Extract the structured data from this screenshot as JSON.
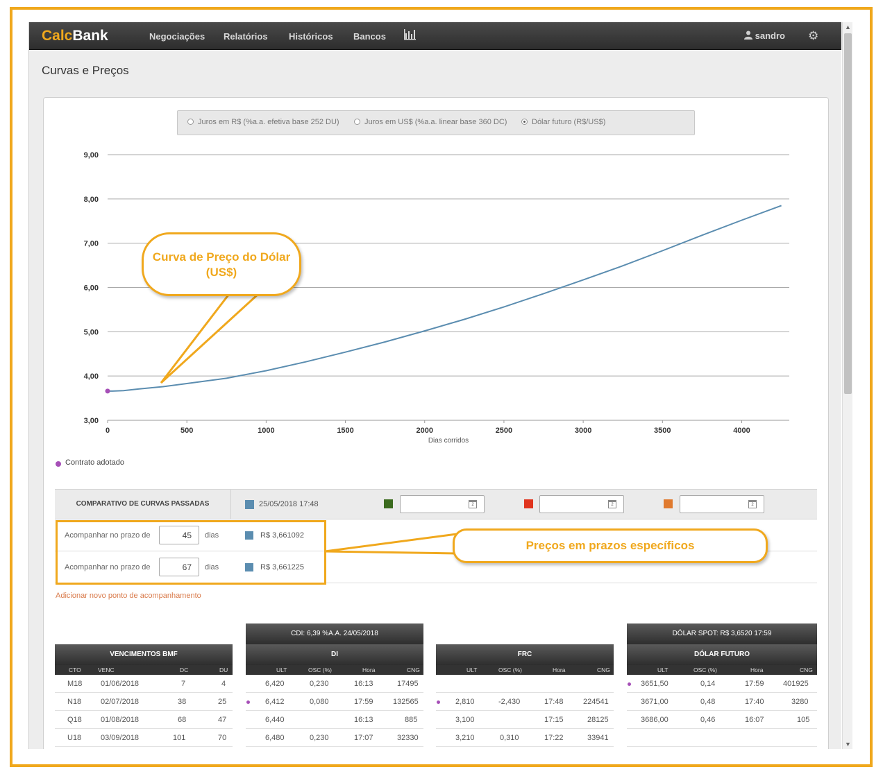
{
  "app": {
    "brand_part1": "Calc",
    "brand_part2": "Bank",
    "nav": [
      "Negociações",
      "Relatórios",
      "Históricos",
      "Bancos"
    ],
    "chart_icon": "bar-chart-icon",
    "user": "sandro",
    "user_icon": "user-icon",
    "settings_icon": "gear-icon"
  },
  "page": {
    "title": "Curvas e Preços"
  },
  "curve_options": [
    {
      "label": "Juros em R$ (%a.a. efetiva base 252 DU)",
      "selected": false
    },
    {
      "label": "Juros em US$ (%a.a. linear base 360 DC)",
      "selected": false
    },
    {
      "label": "Dólar futuro (R$/US$)",
      "selected": true
    }
  ],
  "chart_data": {
    "type": "line",
    "xlabel": "Dias corridos",
    "ylabel": "",
    "xlim": [
      0,
      4300
    ],
    "ylim": [
      3.0,
      9.0
    ],
    "x_ticks": [
      "0",
      "500",
      "1000",
      "1500",
      "2000",
      "2500",
      "3000",
      "3500",
      "4000"
    ],
    "y_ticks": [
      "3,00",
      "4,00",
      "5,00",
      "6,00",
      "7,00",
      "8,00",
      "9,00"
    ],
    "grid": true,
    "series": [
      {
        "color": "#5b8db0",
        "x": [
          0,
          30,
          100,
          200,
          350,
          500,
          750,
          1000,
          1250,
          1500,
          1750,
          2000,
          2250,
          2500,
          2750,
          3000,
          3250,
          3500,
          3750,
          4000,
          4250
        ],
        "y": [
          3.66,
          3.66,
          3.67,
          3.71,
          3.76,
          3.83,
          3.95,
          4.12,
          4.32,
          4.54,
          4.77,
          5.02,
          5.28,
          5.56,
          5.86,
          6.17,
          6.49,
          6.83,
          7.18,
          7.52,
          7.85
        ]
      }
    ],
    "adopted_contract": {
      "x": 0,
      "y": 3.66,
      "color": "#a64fb7"
    },
    "legend": "Contrato adotado",
    "legend_placement": "bottom-left"
  },
  "compare": {
    "title": "COMPARATIVO DE CURVAS PASSADAS",
    "date1": "25/05/2018 17:48",
    "colors": [
      "#5b8db0",
      "#3b6b1e",
      "#e0341e",
      "#e07a2e"
    ]
  },
  "tracking": [
    {
      "label": "Acompanhar no prazo de",
      "days": "45",
      "unit": "dias",
      "value": "R$ 3,661092"
    },
    {
      "label": "Acompanhar no prazo de",
      "days": "67",
      "unit": "dias",
      "value": "R$ 3,661225"
    }
  ],
  "add_point": "Adicionar novo ponto de acompanhamento",
  "callouts": {
    "curve": "Curva de Preço do Dólar (US$)",
    "prices": "Preços em prazos específicos"
  },
  "tables": {
    "bmf": {
      "title": "VENCIMENTOS BMF",
      "cols": [
        "CTO",
        "VENC",
        "DC",
        "DU"
      ],
      "rows": [
        [
          "M18",
          "01/06/2018",
          "7",
          "4"
        ],
        [
          "N18",
          "02/07/2018",
          "38",
          "25"
        ],
        [
          "Q18",
          "01/08/2018",
          "68",
          "47"
        ],
        [
          "U18",
          "03/09/2018",
          "101",
          "70"
        ]
      ]
    },
    "di": {
      "pre": "CDI: 6,39 %A.A.      24/05/2018",
      "title": "DI",
      "cols": [
        "ULT",
        "OSC (%)",
        "Hora",
        "CNG"
      ],
      "rows": [
        [
          "6,420",
          "0,230",
          "16:13",
          "17495"
        ],
        [
          "6,412",
          "0,080",
          "17:59",
          "132565"
        ],
        [
          "6,440",
          "",
          "16:13",
          "885"
        ],
        [
          "6,480",
          "0,230",
          "17:07",
          "32330"
        ]
      ]
    },
    "frc": {
      "title": "FRC",
      "cols": [
        "ULT",
        "OSC (%)",
        "Hora",
        "CNG"
      ],
      "rows": [
        [
          "",
          "",
          "",
          ""
        ],
        [
          "2,810",
          "-2,430",
          "17:48",
          "224541"
        ],
        [
          "3,100",
          "",
          "17:15",
          "28125"
        ],
        [
          "3,210",
          "0,310",
          "17:22",
          "33941"
        ]
      ]
    },
    "dolar": {
      "pre": "DÓLAR SPOT: R$ 3,6520      17:59",
      "title": "DÓLAR FUTURO",
      "cols": [
        "ULT",
        "OSC (%)",
        "Hora",
        "CNG"
      ],
      "rows": [
        [
          "3651,50",
          "0,14",
          "17:59",
          "401925"
        ],
        [
          "3671,00",
          "0,48",
          "17:40",
          "3280"
        ],
        [
          "3686,00",
          "0,46",
          "16:07",
          "105"
        ],
        [
          "",
          "",
          "",
          ""
        ]
      ]
    }
  }
}
